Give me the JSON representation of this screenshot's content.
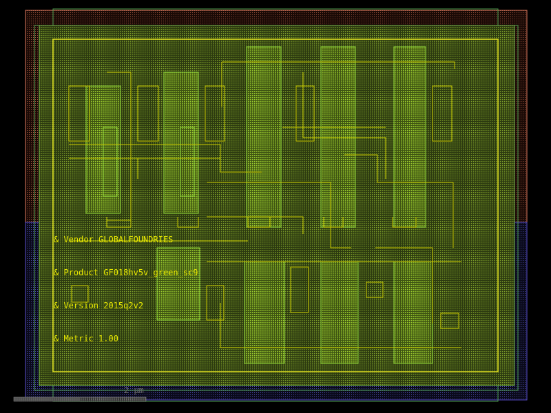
{
  "labels": [
    "& Vendor GLOBALFOUNDRIES",
    "& Product GF018hv5v_green_sc9",
    "& Version 2015q2v2",
    "& Metric 1.00"
  ],
  "scale": {
    "text": "2 μm"
  },
  "colors": {
    "background": "#000000",
    "nwell": "#e07a5f",
    "pwell": "#5a4fcf",
    "diffusion": "#7ac943",
    "poly": "#c8b400",
    "metal1": "#c8c800",
    "text": "#e8e800",
    "scale": "#808080"
  }
}
